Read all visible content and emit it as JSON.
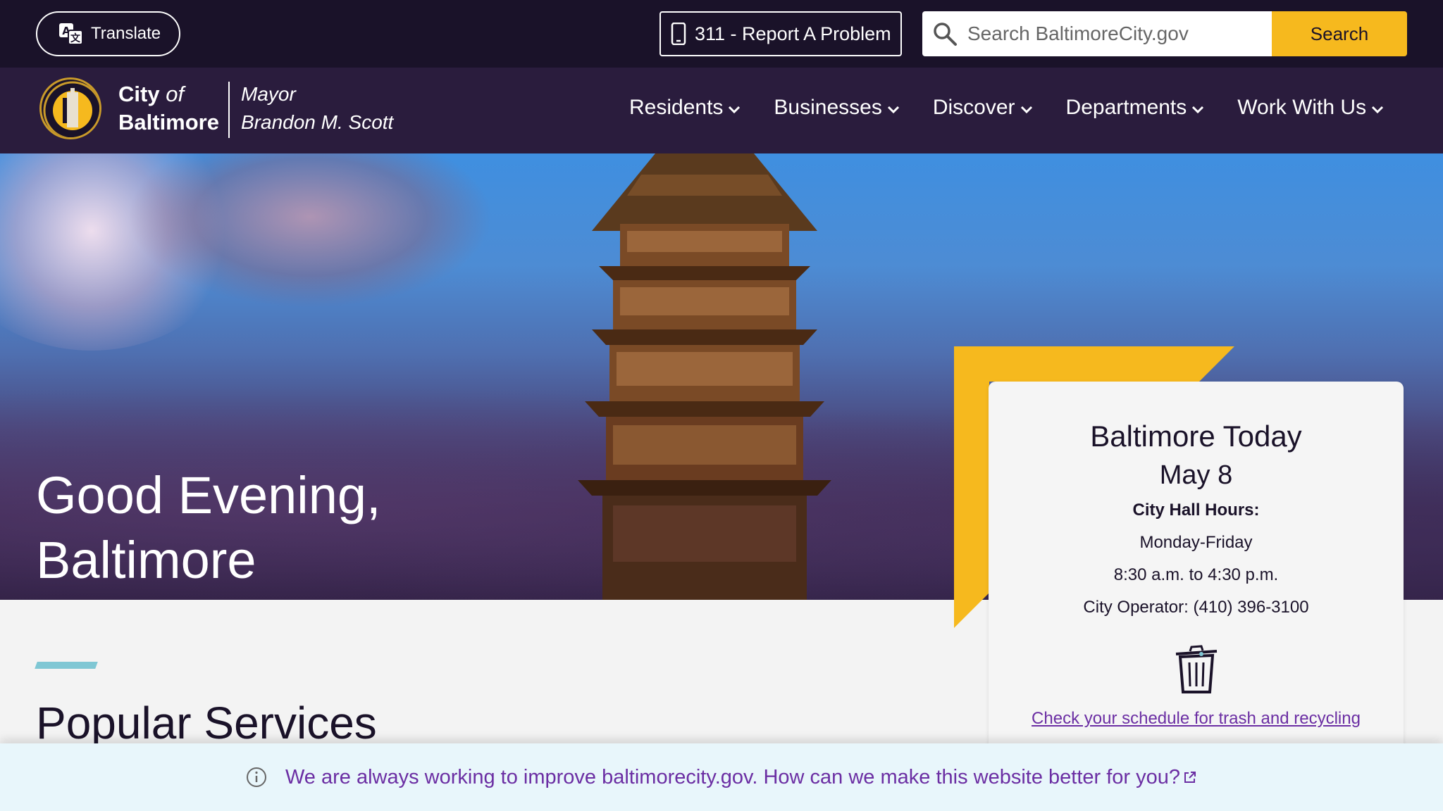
{
  "topbar": {
    "translate_label": "Translate",
    "report_label": "311 - Report A Problem",
    "search_placeholder": "Search BaltimoreCity.gov",
    "search_button": "Search"
  },
  "brand": {
    "city": "City",
    "of": "of",
    "baltimore": "Baltimore",
    "mayor_title": "Mayor",
    "mayor_name": "Brandon M. Scott"
  },
  "nav": {
    "items": [
      {
        "label": "Residents"
      },
      {
        "label": "Businesses"
      },
      {
        "label": "Discover"
      },
      {
        "label": "Departments"
      },
      {
        "label": "Work With Us"
      }
    ]
  },
  "hero": {
    "greeting_line1": "Good Evening,",
    "greeting_line2": "Baltimore"
  },
  "today": {
    "title": "Baltimore Today",
    "date": "May 8",
    "hours_label": "City Hall Hours:",
    "days": "Monday-Friday",
    "hours": "8:30 a.m. to 4:30 p.m.",
    "operator": "City Operator: (410) 396-3100",
    "trash_link": "Check your schedule for trash and recycling"
  },
  "popular": {
    "title": "Popular Services"
  },
  "feedback": {
    "text": "We are always working to improve baltimorecity.gov. How can we make this website better for you?"
  },
  "colors": {
    "top_bar": "#1a1229",
    "nav_bar": "#2a1c3d",
    "accent_yellow": "#f6b91e",
    "link_purple": "#6b2ea3",
    "accent_teal": "#7fc7d4"
  }
}
